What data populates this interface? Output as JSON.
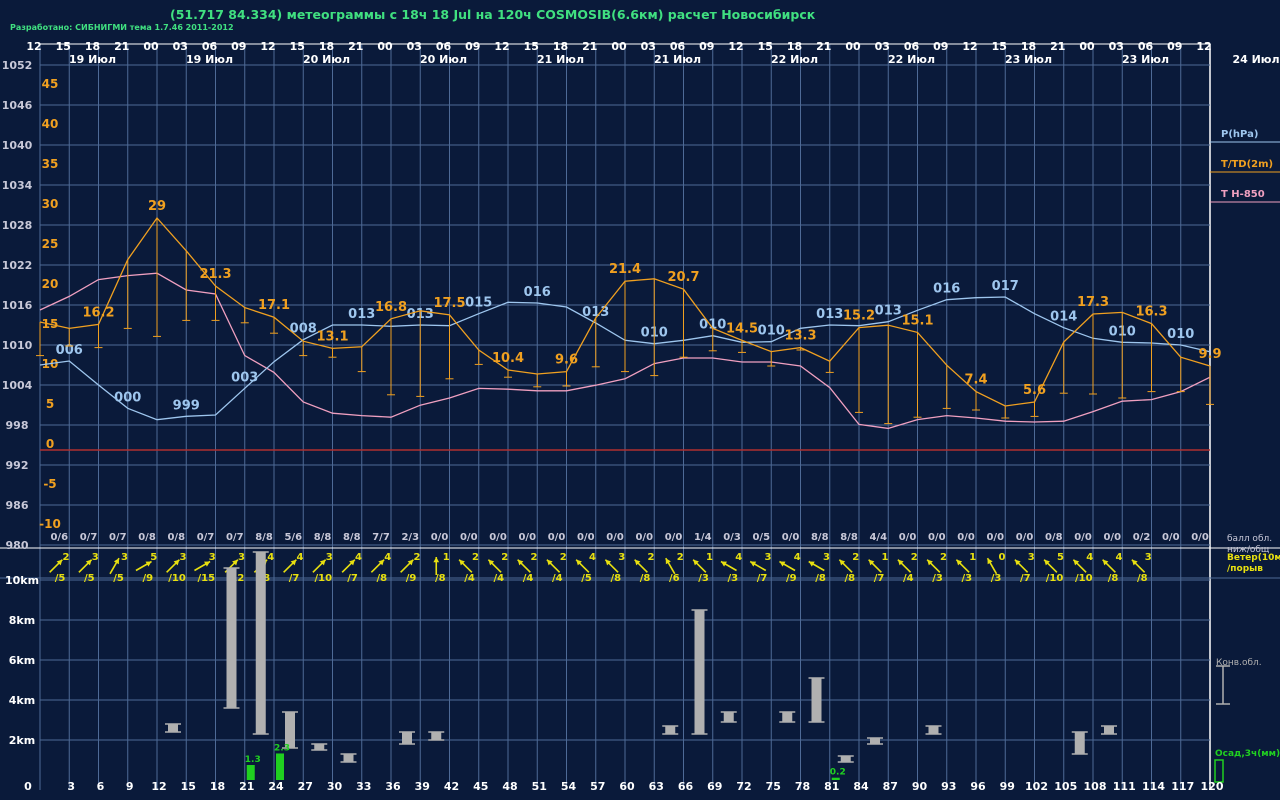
{
  "header": {
    "title": "(51.717 84.334) метеограммы с  18ч 18 Jul на 120ч COSMOSIB(6.6км) расчет Новосибирск",
    "credit": "Разработано: СИБНИГМИ тема 1.7.46 2011-2012"
  },
  "colors": {
    "background": "#0a1a3a",
    "grid": "#4e6a96",
    "pressure": "#9ec6ee",
    "temperature": "#f0a020",
    "t850": "#f0a0c0",
    "zero_line": "#b03030",
    "label": "#c8c8d8",
    "wind_arrow": "#e8e010",
    "cloud_bar": "#b0b0b0",
    "precip": "#20d020"
  },
  "chart_data": {
    "type": "line",
    "hour_labels": [
      "12",
      "15",
      "18",
      "21",
      "00",
      "03",
      "06",
      "09",
      "12",
      "15",
      "18",
      "21",
      "00",
      "03",
      "06",
      "09",
      "12",
      "15",
      "18",
      "21",
      "00",
      "03",
      "06",
      "09",
      "12",
      "15",
      "18",
      "21",
      "00",
      "03",
      "06",
      "09",
      "12",
      "15",
      "18",
      "21",
      "00",
      "03",
      "06",
      "09",
      "12"
    ],
    "day_labels": [
      "19 Июл",
      "19 Июл",
      "20 Июл",
      "20 Июл",
      "21 Июл",
      "21 Июл",
      "22 Июл",
      "22 Июл",
      "23 Июл",
      "23 Июл",
      "24 Июл"
    ],
    "pressure_axis": {
      "label": "P(hPa)",
      "ticks": [
        "1052",
        "1046",
        "1040",
        "1034",
        "1028",
        "1022",
        "1016",
        "1010",
        "1004",
        "998",
        "992",
        "986",
        "980"
      ],
      "range": [
        980,
        1052
      ]
    },
    "temperature_axis": {
      "label": "T/TD(2m)",
      "ticks": [
        "45",
        "40",
        "35",
        "30",
        "25",
        "20",
        "15",
        "10",
        "5",
        "0",
        "-5",
        "-10"
      ],
      "range": [
        -10,
        45
      ]
    },
    "t850_label": "Т Н-850",
    "pressure": {
      "values": [
        1007,
        1007.6,
        1004,
        1000.5,
        998.8,
        999.3,
        999.5,
        1003.5,
        1007.5,
        1010.8,
        1013,
        1013,
        1012.8,
        1013,
        1012.9,
        1014.7,
        1016.4,
        1016.3,
        1015.7,
        1013.3,
        1010.7,
        1010.2,
        1010.7,
        1011.4,
        1010.4,
        1010.5,
        1012.5,
        1013,
        1012.9,
        1013.5,
        1015.2,
        1016.8,
        1017.1,
        1017.2,
        1014.7,
        1012.6,
        1011,
        1010.4,
        1010.3,
        1010,
        1009
      ],
      "labels": [
        {
          "i": 1,
          "text": "006"
        },
        {
          "i": 3,
          "text": "000"
        },
        {
          "i": 5,
          "text": "999"
        },
        {
          "i": 7,
          "text": "003"
        },
        {
          "i": 9,
          "text": "008"
        },
        {
          "i": 11,
          "text": "013"
        },
        {
          "i": 13,
          "text": "013"
        },
        {
          "i": 15,
          "text": "015"
        },
        {
          "i": 17,
          "text": "016"
        },
        {
          "i": 19,
          "text": "013"
        },
        {
          "i": 21,
          "text": "010"
        },
        {
          "i": 23,
          "text": "010"
        },
        {
          "i": 25,
          "text": "010"
        },
        {
          "i": 27,
          "text": "013"
        },
        {
          "i": 29,
          "text": "013"
        },
        {
          "i": 31,
          "text": "016"
        },
        {
          "i": 33,
          "text": "017"
        },
        {
          "i": 35,
          "text": "014"
        },
        {
          "i": 37,
          "text": "010"
        },
        {
          "i": 39,
          "text": "010"
        }
      ]
    },
    "temperature": {
      "values": [
        16,
        15.2,
        15.7,
        23.8,
        29,
        24.9,
        20.5,
        17.8,
        16.6,
        13.6,
        12.7,
        12.9,
        16.4,
        17.4,
        16.9,
        12.5,
        10,
        9.5,
        9.8,
        16.5,
        21.1,
        21.4,
        20.1,
        15.2,
        13.7,
        12.3,
        12.8,
        11.1,
        15.3,
        15.6,
        14.7,
        10.6,
        7.3,
        5.5,
        6,
        13.5,
        17,
        17.2,
        15.8,
        11.6,
        10.5
      ],
      "dewpoint": [
        11.8,
        13,
        12.8,
        15.2,
        14.2,
        16.2,
        16.2,
        15.9,
        14.6,
        11.8,
        11.6,
        9.8,
        6.9,
        6.7,
        8.9,
        10.7,
        9.1,
        7.9,
        8,
        10.4,
        9.8,
        9.3,
        11.6,
        12.4,
        12.2,
        10.5,
        12.5,
        9.7,
        4.7,
        3.3,
        4.1,
        5.2,
        5,
        4,
        4.2,
        7.1,
        7,
        6.5,
        7.3,
        7.3,
        5.7
      ],
      "labels": [
        {
          "i": 2,
          "text": "16.2"
        },
        {
          "i": 4,
          "text": "29"
        },
        {
          "i": 6,
          "text": "21.3"
        },
        {
          "i": 8,
          "text": "17.1"
        },
        {
          "i": 10,
          "text": "13.1"
        },
        {
          "i": 12,
          "text": "16.8"
        },
        {
          "i": 14,
          "text": "17.5"
        },
        {
          "i": 16,
          "text": "10.4"
        },
        {
          "i": 18,
          "text": "9.6"
        },
        {
          "i": 20,
          "text": "21.4"
        },
        {
          "i": 22,
          "text": "20.7"
        },
        {
          "i": 24,
          "text": "14.5"
        },
        {
          "i": 26,
          "text": "13.3"
        },
        {
          "i": 28,
          "text": "15.2"
        },
        {
          "i": 30,
          "text": "15.1"
        },
        {
          "i": 32,
          "text": "7.4"
        },
        {
          "i": 34,
          "text": "5.6"
        },
        {
          "i": 36,
          "text": "17.3"
        },
        {
          "i": 38,
          "text": "16.3"
        },
        {
          "i": 40,
          "text": "9.9"
        }
      ]
    },
    "t850": {
      "values": [
        17.5,
        19.2,
        21.3,
        21.8,
        22.1,
        20,
        19.5,
        11.8,
        9.7,
        6,
        4.6,
        4.3,
        4.1,
        5.6,
        6.5,
        7.7,
        7.6,
        7.4,
        7.4,
        8.1,
        8.9,
        10.8,
        11.5,
        11.5,
        11,
        11,
        10.5,
        7.8,
        3.2,
        2.7,
        3.8,
        4.3,
        4,
        3.6,
        3.5,
        3.6,
        4.8,
        6.1,
        6.3,
        7.3,
        9.1
      ]
    },
    "cloud_text": [
      "0/6",
      "0/7",
      "0/7",
      "0/8",
      "0/8",
      "0/7",
      "0/7",
      "8/8",
      "5/6",
      "8/8",
      "8/8",
      "7/7",
      "2/3",
      "0/0",
      "0/0",
      "0/0",
      "0/0",
      "0/0",
      "0/0",
      "0/0",
      "0/0",
      "0/0",
      "1/4",
      "0/3",
      "0/5",
      "0/0",
      "8/8",
      "8/8",
      "4/4",
      "0/0",
      "0/0",
      "0/0",
      "0/0",
      "0/0",
      "0/8",
      "0/0",
      "0/0",
      "0/2",
      "0/0",
      "0/0"
    ],
    "cloud_label": [
      "балл обл.",
      "ниж/общ"
    ],
    "wind": {
      "label": [
        "Ветер(10м)",
        "/порыв"
      ],
      "speed": [
        "2",
        "3",
        "3",
        "5",
        "3",
        "3",
        "3",
        "4",
        "4",
        "3",
        "4",
        "4",
        "2",
        "1",
        "2",
        "2",
        "2",
        "2",
        "4",
        "3",
        "2",
        "2",
        "1",
        "4",
        "3",
        "4",
        "3",
        "2",
        "1",
        "2",
        "2",
        "1",
        "0",
        "3",
        "5",
        "4",
        "4",
        "3"
      ],
      "gust": [
        "/5",
        "/5",
        "/5",
        "/9",
        "/10",
        "/15",
        "/12",
        "/8",
        "/7",
        "/10",
        "/7",
        "/8",
        "/9",
        "/8",
        "/4",
        "/4",
        "/4",
        "/4",
        "/5",
        "/8",
        "/8",
        "/6",
        "/3",
        "/3",
        "/7",
        "/9",
        "/8",
        "/8",
        "/7",
        "/4",
        "/3",
        "/3",
        "/3",
        "/7",
        "/10",
        "/10",
        "/8",
        "/8"
      ],
      "dir_deg": [
        135,
        135,
        120,
        150,
        135,
        150,
        135,
        135,
        135,
        135,
        135,
        135,
        135,
        90,
        45,
        45,
        45,
        45,
        45,
        45,
        45,
        60,
        45,
        30,
        30,
        30,
        30,
        45,
        45,
        45,
        45,
        45,
        60,
        45,
        45,
        45,
        45,
        45
      ]
    },
    "cloud_axis": {
      "ticks": [
        "10km",
        "8km",
        "6km",
        "4km",
        "2km"
      ],
      "range": [
        0,
        11
      ],
      "label": "Конв.обл."
    },
    "convective_clouds": [
      {
        "slot": 4,
        "bottom": 2.4,
        "top": 2.8
      },
      {
        "slot": 6,
        "bottom": 3.6,
        "top": 10.6
      },
      {
        "slot": 7,
        "bottom": 2.3,
        "top": 11.4
      },
      {
        "slot": 8,
        "bottom": 1.6,
        "top": 3.4
      },
      {
        "slot": 9,
        "bottom": 1.5,
        "top": 1.8
      },
      {
        "slot": 10,
        "bottom": 0.9,
        "top": 1.3
      },
      {
        "slot": 12,
        "bottom": 1.8,
        "top": 2.4
      },
      {
        "slot": 13,
        "bottom": 2.0,
        "top": 2.4
      },
      {
        "slot": 21,
        "bottom": 2.3,
        "top": 2.7
      },
      {
        "slot": 22,
        "bottom": 2.3,
        "top": 8.5
      },
      {
        "slot": 23,
        "bottom": 2.9,
        "top": 3.4
      },
      {
        "slot": 25,
        "bottom": 2.9,
        "top": 3.4
      },
      {
        "slot": 26,
        "bottom": 2.9,
        "top": 5.1
      },
      {
        "slot": 27,
        "bottom": 0.9,
        "top": 1.2
      },
      {
        "slot": 28,
        "bottom": 1.8,
        "top": 2.1
      },
      {
        "slot": 30,
        "bottom": 2.3,
        "top": 2.7
      },
      {
        "slot": 35,
        "bottom": 1.3,
        "top": 2.4
      },
      {
        "slot": 36,
        "bottom": 2.3,
        "top": 2.7
      }
    ],
    "precipitation": {
      "label": "Осад,3ч(мм)",
      "bars": [
        {
          "slot": 7,
          "value": 1.3,
          "text": "1.3"
        },
        {
          "slot": 8,
          "value": 2.3,
          "text": "2.3"
        },
        {
          "slot": 27,
          "value": 0.2,
          "text": "0.2"
        }
      ],
      "range": [
        0,
        2.6
      ]
    },
    "fcst_hours": [
      "0",
      "3",
      "6",
      "9",
      "12",
      "15",
      "18",
      "21",
      "24",
      "27",
      "30",
      "33",
      "36",
      "39",
      "42",
      "45",
      "48",
      "51",
      "54",
      "57",
      "60",
      "63",
      "66",
      "69",
      "72",
      "75",
      "78",
      "81",
      "84",
      "87",
      "90",
      "93",
      "96",
      "99",
      "102",
      "105",
      "108",
      "111",
      "114",
      "117",
      "120"
    ]
  }
}
